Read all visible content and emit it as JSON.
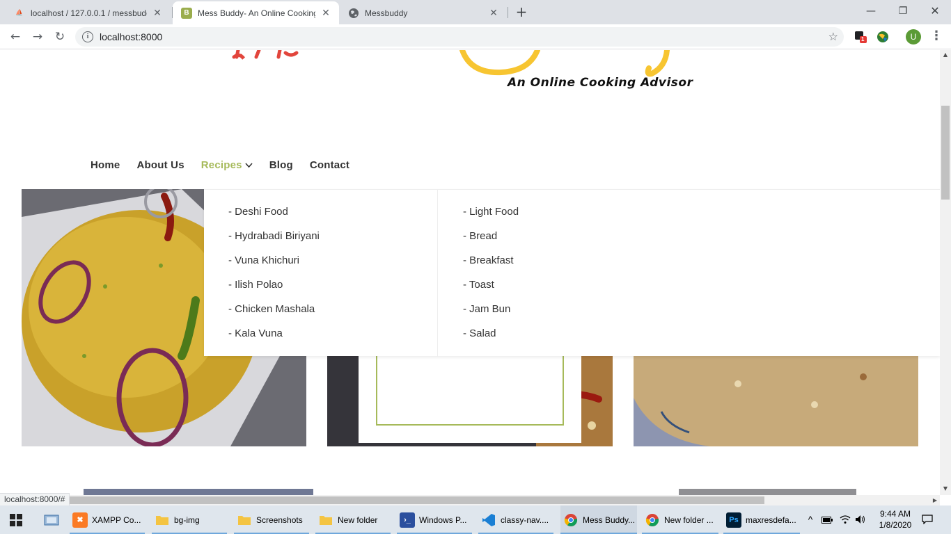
{
  "browser": {
    "tabs": [
      {
        "title": "localhost / 127.0.0.1 / messbuddy",
        "favicon": "phpmyadmin-icon"
      },
      {
        "title": "Mess Buddy- An Online Cooking Advisor",
        "favicon": "bootstrap-icon",
        "active": true
      },
      {
        "title": "Messbuddy",
        "favicon": "globe-icon"
      }
    ],
    "close_glyph": "✕",
    "new_tab_glyph": "+",
    "url": "localhost:8000",
    "back_glyph": "←",
    "forward_glyph": "→",
    "reload_glyph": "↻",
    "info_glyph": "i",
    "star_glyph": "☆",
    "profile_initial": "U",
    "extension_badge": "1",
    "menu_glyph": "⋮",
    "window": {
      "minimize": "—",
      "restore": "❐",
      "close": "✕"
    }
  },
  "site": {
    "tagline": "An Online Cooking Advisor",
    "nav": [
      {
        "label": "Home"
      },
      {
        "label": "About Us"
      },
      {
        "label": "Recipes",
        "active": true,
        "has_dropdown": true
      },
      {
        "label": "Blog"
      },
      {
        "label": "Contact"
      }
    ],
    "chevron": "⌵",
    "dropdown": {
      "left": [
        "- Deshi Food",
        "- Hydrabadi Biriyani",
        "- Vuna Khichuri",
        "- Ilish Polao",
        "- Chicken Mashala",
        "- Kala Vuna"
      ],
      "right": [
        "- Light Food",
        "- Bread",
        "- Breakfast",
        "- Toast",
        "- Jam Bun",
        "- Salad"
      ]
    },
    "accent_color": "#a6ba5a"
  },
  "status_bar": {
    "text": "localhost:8000/#"
  },
  "taskbar": {
    "items": [
      {
        "label": "XAMPP Co...",
        "icon": "xampp-icon"
      },
      {
        "label": "bg-img",
        "icon": "folder-icon"
      },
      {
        "label": "Screenshots",
        "icon": "folder-icon"
      },
      {
        "label": "New folder",
        "icon": "folder-icon"
      },
      {
        "label": "Windows P...",
        "icon": "powershell-icon"
      },
      {
        "label": "classy-nav....",
        "icon": "vscode-icon"
      },
      {
        "label": "Mess Buddy...",
        "icon": "chrome-icon",
        "active": true
      },
      {
        "label": "New folder ...",
        "icon": "chrome-icon"
      },
      {
        "label": "maxresdefa...",
        "icon": "photoshop-icon"
      }
    ],
    "tray_up_glyph": "^",
    "time": "9:44 AM",
    "date": "1/8/2020"
  }
}
